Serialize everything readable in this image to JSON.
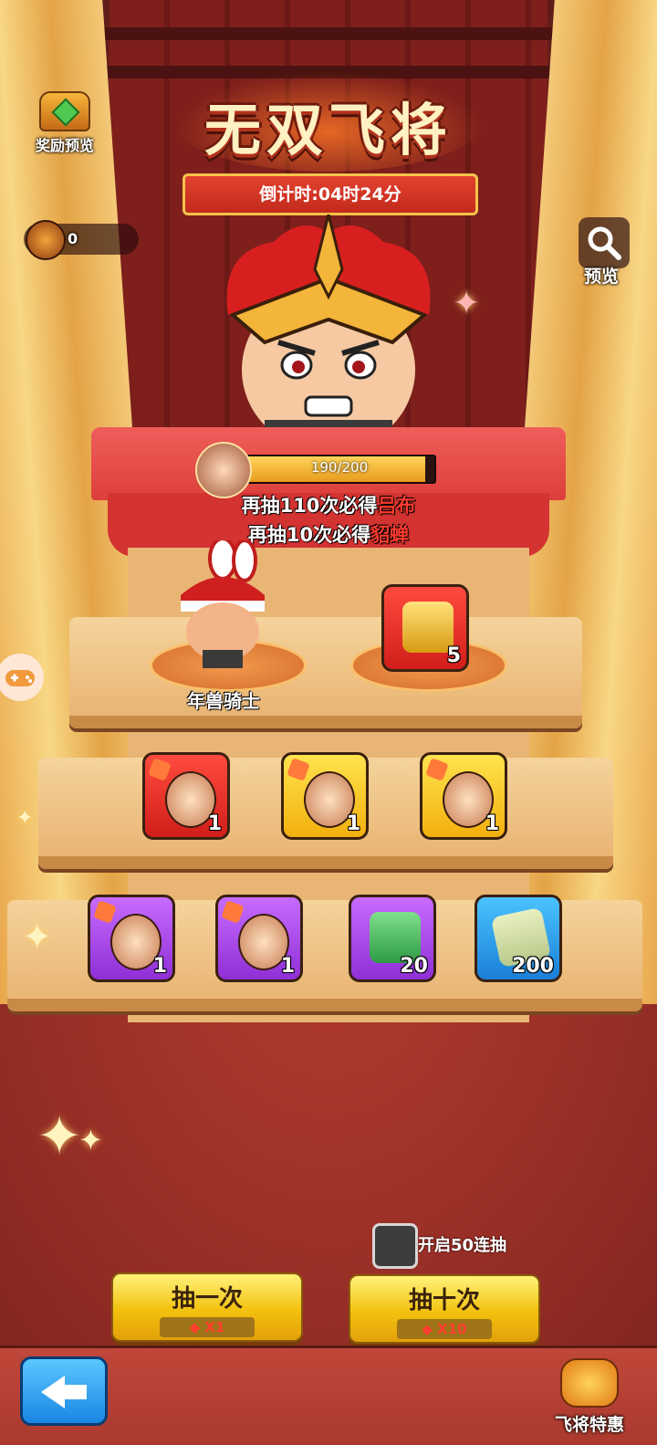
{
  "event": {
    "title": "无双飞将",
    "countdown": "倒计时:04时24分"
  },
  "top_left": {
    "reward_preview_label": "奖励预览",
    "currency_count": "0"
  },
  "top_right": {
    "preview_label": "预览"
  },
  "progress": {
    "text": "190/200",
    "fraction": 0.95
  },
  "pity": {
    "line1_prefix": "再抽110次必得",
    "line1_hero": "吕布",
    "line2_prefix": "再抽10次必得",
    "line2_hero": "貂蝉"
  },
  "shelf_top": {
    "hero_label": "年兽骑士",
    "item_count": "5"
  },
  "shelf_middle": [
    {
      "color": "red",
      "icon": "hero-fragment-icon",
      "count": "1"
    },
    {
      "color": "yellow",
      "icon": "hero-fragment-icon",
      "count": "1"
    },
    {
      "color": "yellow",
      "icon": "hero-fragment-icon",
      "count": "1"
    }
  ],
  "shelf_bottom": [
    {
      "color": "purple",
      "icon": "hero-fragment-icon",
      "count": "1"
    },
    {
      "color": "purple",
      "icon": "hero-fragment-icon",
      "count": "1"
    },
    {
      "color": "purple",
      "icon": "jade-seal-icon",
      "count": "20"
    },
    {
      "color": "blue",
      "icon": "scroll-icon",
      "count": "200"
    }
  ],
  "multi_draw": {
    "label": "开启50连抽",
    "checked": false
  },
  "draw_buttons": {
    "single": {
      "label": "抽一次",
      "cost": "X1"
    },
    "ten": {
      "label": "抽十次",
      "cost": "X10"
    }
  },
  "bottom": {
    "special_offer_label": "飞将特惠"
  },
  "colors": {
    "highlight_red": "#ff3b2e",
    "button_yellow": "#f3c10e",
    "back_blue": "#1a86e3"
  }
}
